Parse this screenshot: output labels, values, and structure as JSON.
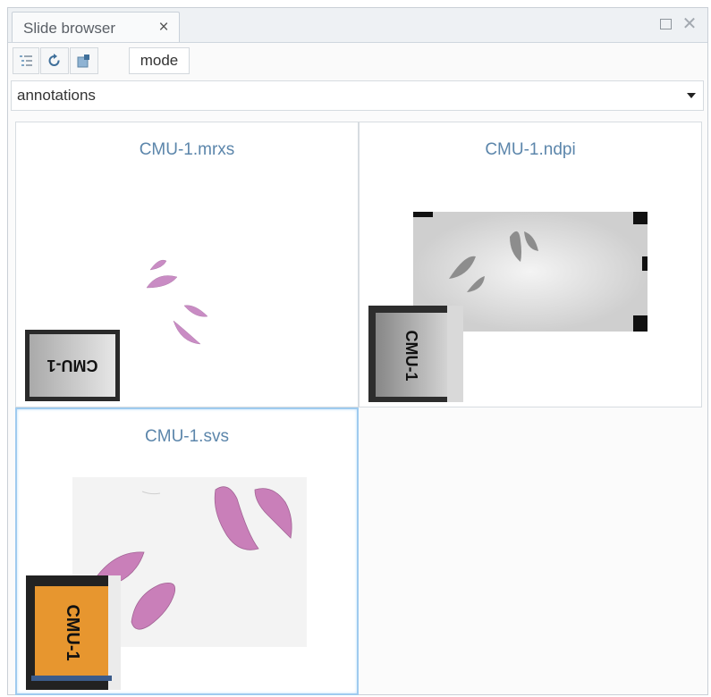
{
  "panel": {
    "tab_label": "Slide browser",
    "tab_close": "×",
    "close_glyph": "✕"
  },
  "toolbar": {
    "mode_label": "mode"
  },
  "filter": {
    "selected": "annotations"
  },
  "slides": [
    {
      "name": "CMU-1.mrxs",
      "label_text": "CMU-1",
      "selected": false
    },
    {
      "name": "CMU-1.ndpi",
      "label_text": "CMU-1",
      "selected": false
    },
    {
      "name": "CMU-1.svs",
      "label_text": "CMU-1",
      "selected": true
    }
  ],
  "colors": {
    "accent_title": "#5c86ab",
    "selection_border": "#9fcbef",
    "tissue": "#c98cc4",
    "svs_label": "#e7962f"
  }
}
